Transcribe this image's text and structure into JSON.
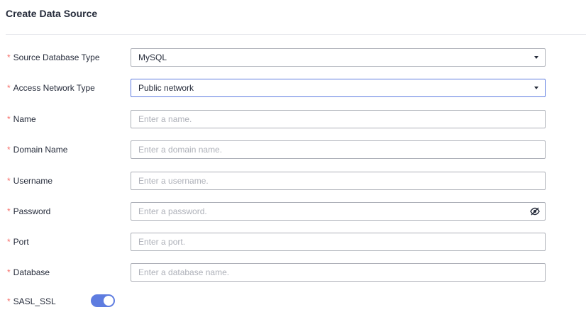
{
  "page": {
    "title": "Create Data Source"
  },
  "fields": {
    "source_db_type": {
      "label": "Source Database Type",
      "value": "MySQL"
    },
    "access_network_type": {
      "label": "Access Network Type",
      "value": "Public network"
    },
    "name": {
      "label": "Name",
      "placeholder": "Enter a name."
    },
    "domain_name": {
      "label": "Domain Name",
      "placeholder": "Enter a domain name."
    },
    "username": {
      "label": "Username",
      "placeholder": "Enter a username."
    },
    "password": {
      "label": "Password",
      "placeholder": "Enter a password."
    },
    "port": {
      "label": "Port",
      "placeholder": "Enter a port."
    },
    "database": {
      "label": "Database",
      "placeholder": "Enter a database name."
    },
    "sasl_ssl": {
      "label": "SASL_SSL",
      "enabled": true
    }
  },
  "required_marker": "*",
  "icons": {
    "select_caret": "chevron-down-icon",
    "password_toggle": "eye-off-icon"
  },
  "colors": {
    "accent": "#5e7ce0",
    "required": "#f66f6a",
    "border": "#adb0b8",
    "placeholder": "#adb0b8"
  }
}
